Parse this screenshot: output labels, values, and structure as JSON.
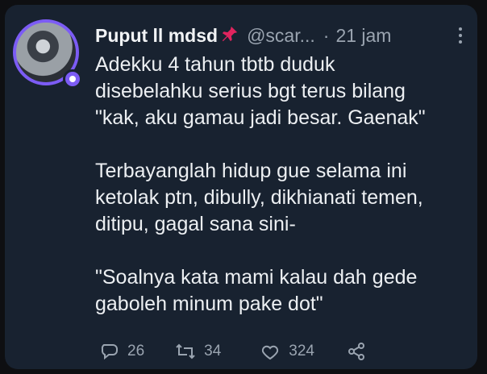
{
  "tweet": {
    "author_name": "Puput ll mdsd",
    "handle": "@scar...",
    "separator": "·",
    "time": "21 jam",
    "lines": [
      [
        "Adekku 4 tahun tbtb duduk",
        "disebelahku serius bgt terus bilang",
        "\"kak, aku gamau jadi besar. Gaenak\""
      ],
      [
        "Terbayanglah hidup gue selama ini",
        "ketolak ptn, dibully, dikhianati temen,",
        "ditipu, gagal sana sini-"
      ],
      [
        "\"Soalnya kata mami kalau dah gede",
        "gaboleh minum pake dot\""
      ]
    ],
    "stats": {
      "replies": "26",
      "retweets": "34",
      "likes": "324"
    }
  },
  "icons": {
    "pin": "pushpin-icon",
    "reply": "reply-icon",
    "retweet": "retweet-icon",
    "like": "heart-icon",
    "share": "share-icon",
    "more": "more-icon"
  },
  "colors": {
    "card_bg": "#182230",
    "accent": "#7c5cf5",
    "muted": "#9aa4b0",
    "pin": "#e0245e"
  }
}
